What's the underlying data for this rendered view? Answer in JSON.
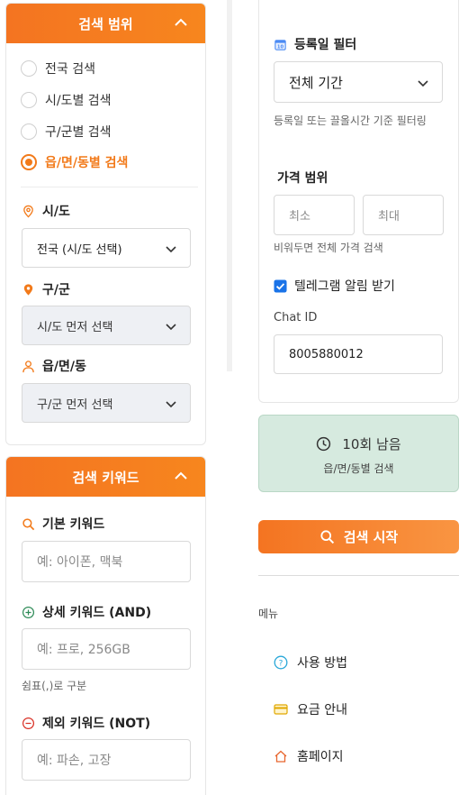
{
  "left": {
    "scope_card": {
      "title": "검색 범위",
      "radios": [
        {
          "label": "전국 검색",
          "selected": false
        },
        {
          "label": "시/도별 검색",
          "selected": false
        },
        {
          "label": "구/군별 검색",
          "selected": false
        },
        {
          "label": "읍/면/동별 검색",
          "selected": true
        }
      ],
      "sido": {
        "label": "시/도",
        "value": "전국 (시/도 선택)"
      },
      "gugun": {
        "label": "구/군",
        "value": "시/도 먼저 선택"
      },
      "dong": {
        "label": "읍/면/동",
        "value": "구/군 먼저 선택"
      }
    },
    "keyword_card": {
      "title": "검색 키워드",
      "basic": {
        "label": "기본 키워드",
        "placeholder": "예: 아이폰, 맥북"
      },
      "detail": {
        "label": "상세 키워드 (AND)",
        "placeholder": "예: 프로, 256GB",
        "hint": "쉼표(,)로 구분"
      },
      "exclude": {
        "label": "제외 키워드 (NOT)",
        "placeholder": "예: 파손, 고장"
      }
    }
  },
  "right": {
    "date_filter": {
      "label": "등록일 필터",
      "value": "전체 기간",
      "hint": "등록일 또는 끌올시간 기준 필터링"
    },
    "price": {
      "label": "가격 범위",
      "min_placeholder": "최소",
      "max_placeholder": "최대",
      "hint": "비워두면 전체 가격 검색"
    },
    "telegram": {
      "label": "텔레그램 알림 받기",
      "checked": true
    },
    "chat_id": {
      "label": "Chat ID",
      "value": "8005880012"
    },
    "status": {
      "remaining": "10회 남음",
      "scope": "읍/면/동별 검색"
    },
    "start_button": "검색 시작",
    "menu": {
      "title": "메뉴",
      "items": [
        {
          "label": "사용 방법",
          "icon": "help-icon"
        },
        {
          "label": "요금 안내",
          "icon": "card-icon"
        },
        {
          "label": "홈페이지",
          "icon": "home-icon"
        }
      ]
    }
  },
  "colors": {
    "accent": "#f47421",
    "status_bg": "#d6eadf",
    "checkbox": "#1a73e8"
  }
}
